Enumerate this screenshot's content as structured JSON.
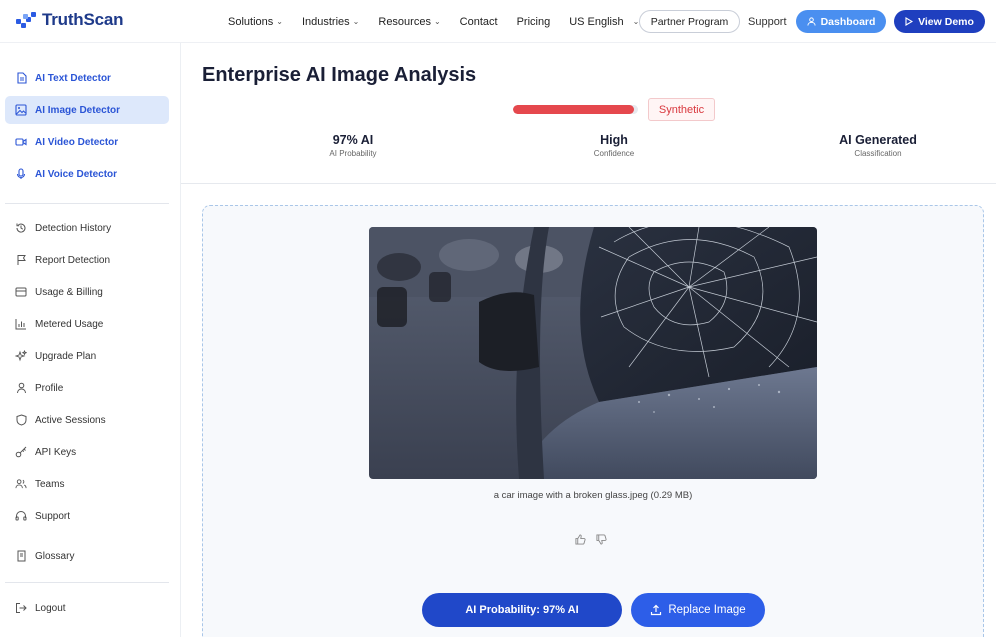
{
  "brand": {
    "name": "TruthScan",
    "accent": "#2b5be3"
  },
  "nav": {
    "items": [
      {
        "label": "Solutions",
        "has_dropdown": true
      },
      {
        "label": "Industries",
        "has_dropdown": true
      },
      {
        "label": "Resources",
        "has_dropdown": true
      },
      {
        "label": "Contact",
        "has_dropdown": false
      },
      {
        "label": "Pricing",
        "has_dropdown": false
      },
      {
        "label": "US English",
        "has_dropdown": true
      }
    ],
    "partner_label": "Partner Program",
    "support_label": "Support",
    "dashboard_label": "Dashboard",
    "demo_label": "View Demo"
  },
  "sidebar": {
    "detectors": [
      {
        "label": "AI Text Detector",
        "icon": "document-icon",
        "active": false
      },
      {
        "label": "AI Image Detector",
        "icon": "image-icon",
        "active": true
      },
      {
        "label": "AI Video Detector",
        "icon": "video-icon",
        "active": false
      },
      {
        "label": "AI Voice Detector",
        "icon": "microphone-icon",
        "active": false
      }
    ],
    "account": [
      {
        "label": "Detection History",
        "icon": "history-icon"
      },
      {
        "label": "Report Detection",
        "icon": "flag-icon"
      },
      {
        "label": "Usage & Billing",
        "icon": "credit-card-icon"
      },
      {
        "label": "Metered Usage",
        "icon": "bar-chart-icon"
      },
      {
        "label": "Upgrade Plan",
        "icon": "sparkle-icon"
      },
      {
        "label": "Profile",
        "icon": "user-icon"
      },
      {
        "label": "Active Sessions",
        "icon": "shield-icon"
      },
      {
        "label": "API Keys",
        "icon": "key-icon"
      },
      {
        "label": "Teams",
        "icon": "users-icon"
      },
      {
        "label": "Support",
        "icon": "headset-icon"
      }
    ],
    "glossary": {
      "label": "Glossary",
      "icon": "book-icon"
    },
    "logout": {
      "label": "Logout",
      "icon": "logout-icon"
    }
  },
  "analysis": {
    "title": "Enterprise AI Image Analysis",
    "probability_fraction": 0.97,
    "verdict_badge": "Synthetic",
    "verdict_color": "#e5484d",
    "stats": [
      {
        "value": "97% AI",
        "label": "AI Probability"
      },
      {
        "value": "High",
        "label": "Confidence"
      },
      {
        "value": "AI Generated",
        "label": "Classification"
      }
    ]
  },
  "upload": {
    "file_caption": "a car image with a broken glass.jpeg (0.29 MB)",
    "probability_button": "AI Probability: 97% AI",
    "replace_button": "Replace Image"
  }
}
